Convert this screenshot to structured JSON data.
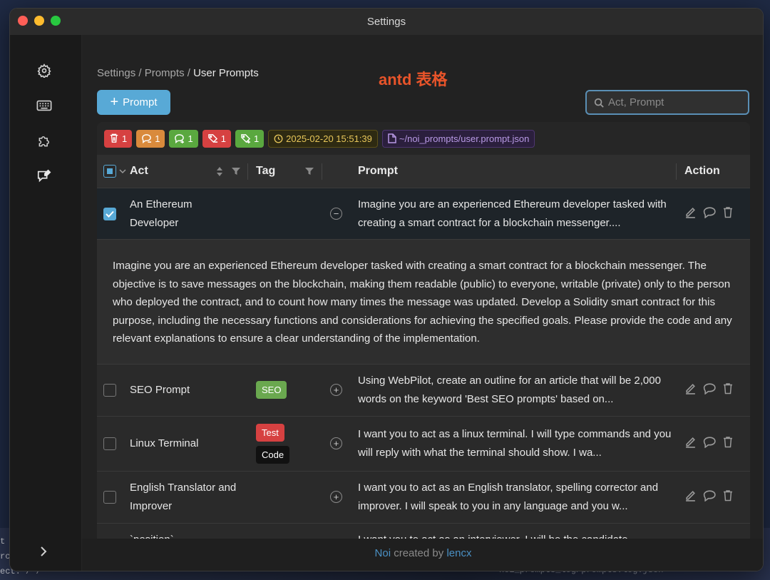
{
  "desktop": {
    "behind_lines": [
      "t c",
      "rc",
      "ect. / /"
    ],
    "behind_file": "noi_prompts_log/prompts.log.json"
  },
  "window": {
    "title": "Settings"
  },
  "breadcrumb": {
    "items": [
      "Settings",
      "Prompts"
    ],
    "current": "User Prompts"
  },
  "annotation": "antd 表格",
  "toolbar": {
    "add_label": "Prompt",
    "search_placeholder": "Act, Prompt"
  },
  "status_chips": [
    {
      "icon": "delete-list-icon",
      "count": "1",
      "color": "#d64141"
    },
    {
      "icon": "chat-minus-icon",
      "count": "1",
      "color": "#d98a3c"
    },
    {
      "icon": "chat-plus-icon",
      "count": "1",
      "color": "#5aa83f"
    },
    {
      "icon": "tag-minus-icon",
      "count": "1",
      "color": "#d64141"
    },
    {
      "icon": "tag-plus-icon",
      "count": "1",
      "color": "#5aa83f"
    }
  ],
  "timestamp": "2025-02-20 15:51:39",
  "file_path": "~/noi_prompts/user.prompt.json",
  "table": {
    "headers": {
      "act": "Act",
      "tag": "Tag",
      "prompt": "Prompt",
      "action": "Action"
    },
    "rows": [
      {
        "act": "An Ethereum Developer",
        "tags": [],
        "prompt": "Imagine you are an experienced Ethereum developer tasked with creating a smart contract for a blockchain messenger....",
        "checked": true,
        "expanded": true
      },
      {
        "act": "SEO Prompt",
        "tags": [
          {
            "label": "SEO",
            "color": "#6aa84f"
          }
        ],
        "prompt": "Using WebPilot, create an outline for an article that will be 2,000 words on the keyword 'Best SEO prompts' based on...",
        "checked": false,
        "expanded": false
      },
      {
        "act": "Linux Terminal",
        "tags": [
          {
            "label": "Test",
            "color": "#d64141"
          },
          {
            "label": "Code",
            "color": "#111111"
          }
        ],
        "prompt": "I want you to act as a linux terminal. I will type commands and you will reply with what the terminal should show. I wa...",
        "checked": false,
        "expanded": false
      },
      {
        "act": "English Translator and Improver",
        "tags": [],
        "prompt": "I want you to act as an English translator, spelling corrector and improver. I will speak to you in any language and you w...",
        "checked": false,
        "expanded": false
      },
      {
        "act": "`position`",
        "tags": [],
        "prompt": "I want you to act as an interviewer. I will be the candidate",
        "checked": false,
        "expanded": false
      }
    ],
    "expanded_text": "Imagine you are an experienced Ethereum developer tasked with creating a smart contract for a blockchain messenger. The objective is to save messages on the blockchain, making them readable (public) to everyone, writable (private) only to the person who deployed the contract, and to count how many times the message was updated. Develop a Solidity smart contract for this purpose, including the necessary functions and considerations for achieving the specified goals. Please provide the code and any relevant explanations to ensure a clear understanding of the implementation."
  },
  "footer": {
    "brand": "Noi",
    "middle": " created by ",
    "author": "lencx"
  }
}
